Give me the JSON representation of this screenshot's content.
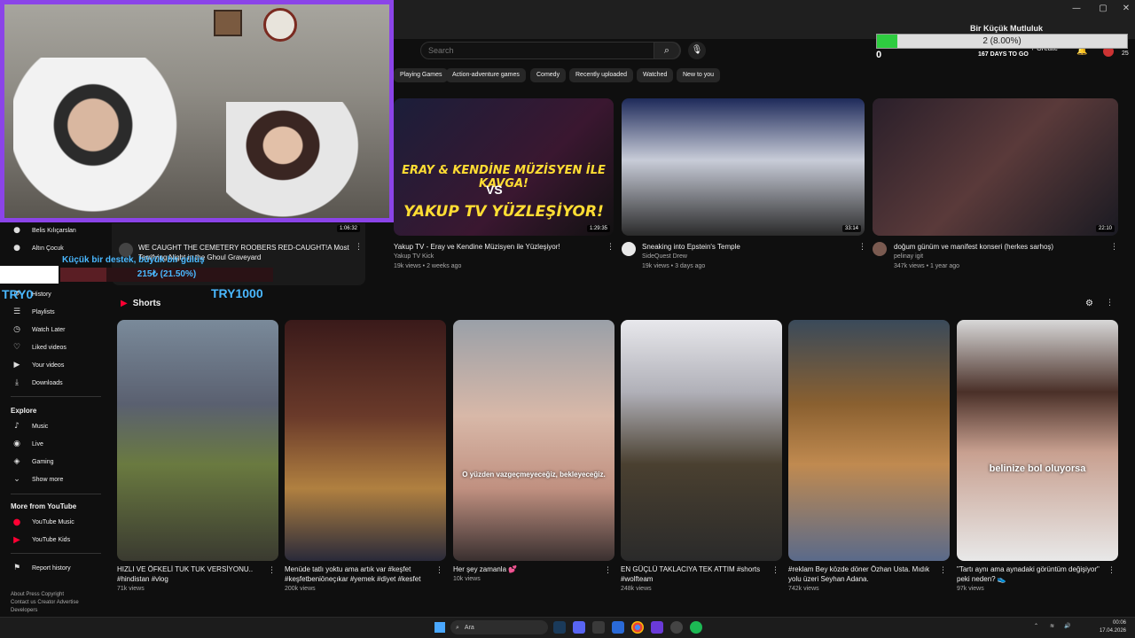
{
  "browser": {
    "title": "Bir Küçük Mutluluk",
    "controls": [
      "—",
      "▢",
      "✕"
    ]
  },
  "header": {
    "search_placeholder": "Search",
    "create_label": "+ Create",
    "notification_count": "25"
  },
  "goal": {
    "label": "2 (8.00%)",
    "progress": 0.08,
    "min": "0",
    "days": "167 DAYS TO GO"
  },
  "chips": [
    "Playing Games",
    "Action-adventure games",
    "Comedy",
    "Recently uploaded",
    "Watched",
    "New to you"
  ],
  "videos": [
    {
      "title": "Yakup TV - Eray ve Kendine Müzisyen ile Yüzleşiyor!",
      "channel": "Yakup TV Kick",
      "meta": "19k views • 2 weeks ago",
      "duration": "1:29:35",
      "thumb_text_1": "YAKUP TV YÜZLEŞİYOR!",
      "thumb_text_2": "ERAY & KENDİNE MÜZİSYEN İLE KAVGA!",
      "thumb_vs": "VS"
    },
    {
      "title": "Sneaking into Epstein's Temple",
      "channel": "SideQuest Drew",
      "meta": "19k views • 3 days ago",
      "duration": "33:14"
    },
    {
      "title": "doğum günüm ve manifest konseri (herkes sarhoş)",
      "channel": "pelinay igit",
      "meta": "347k views • 1 year ago",
      "duration": "22:10"
    }
  ],
  "left_video": {
    "title": "WE CAUGHT THE CEMETERY ROOBERS RED-CAUGHT!A Most Terrifying Night in the Ghoul Graveyard",
    "duration": "1:06:32"
  },
  "sidebar": {
    "subs": [
      "Belis Kılıçarslan",
      "Altın Çocuk"
    ],
    "you": [
      {
        "label": "History",
        "icon": "↺"
      },
      {
        "label": "Playlists",
        "icon": "☰"
      },
      {
        "label": "Watch Later",
        "icon": "◷"
      },
      {
        "label": "Liked videos",
        "icon": "♡"
      },
      {
        "label": "Your videos",
        "icon": "▶"
      },
      {
        "label": "Downloads",
        "icon": "⤓"
      }
    ],
    "explore_heading": "Explore",
    "explore": [
      {
        "label": "Music",
        "icon": "♪"
      },
      {
        "label": "Live",
        "icon": "◉"
      },
      {
        "label": "Gaming",
        "icon": "◈"
      },
      {
        "label": "Show more",
        "icon": "⌄"
      }
    ],
    "more_heading": "More from YouTube",
    "more": [
      {
        "label": "YouTube Music"
      },
      {
        "label": "YouTube Kids"
      }
    ],
    "report": "Report history",
    "footer_1": "About  Press  Copyright",
    "footer_2": "Contact us  Creator  Advertise",
    "footer_3": "Developers"
  },
  "donation": {
    "text": "Küçük bir destek, büyük bir gülüş",
    "label": "215₺ (21.50%)",
    "progress": 0.215,
    "min": "TRY0",
    "max": "TRY1000"
  },
  "shorts_heading": "Shorts",
  "shorts": [
    {
      "title": "HIZLI VE ÖFKELİ TUK TUK VERSİYONU.. #hindistan #vlog",
      "views": "71k views",
      "overlay": ""
    },
    {
      "title": "Menüde tatlı yoktu ama artık var #keşfet #keşfetbeniöneçıkar #yemek #diyet #kesfet",
      "views": "200k views",
      "overlay": ""
    },
    {
      "title": "Her şey zamanla 💕",
      "views": "10k views",
      "overlay": "O yüzden vazgeçmeyeceğiz, bekleyeceğiz."
    },
    {
      "title": "EN GÜÇLÜ TAKLACIYA TEK ATTIM #shorts #wolfteam",
      "views": "248k views",
      "overlay": ""
    },
    {
      "title": "#reklam Bey közde döner Özhan Usta. Mıdık yolu üzeri Seyhan Adana.",
      "views": "742k views",
      "overlay": ""
    },
    {
      "title": "\"Tartı aynı ama aynadaki görüntüm değişiyor\" peki neden? 👟",
      "views": "97k views",
      "overlay": "belinize bol oluyorsa"
    }
  ],
  "taskbar": {
    "search": "Ara",
    "time": "00:06",
    "date": "17.04.2026"
  },
  "colors": {
    "accent_purple": "#8b44e8",
    "donation_blue": "#4ab8ff",
    "goal_green": "#2ecc40"
  }
}
